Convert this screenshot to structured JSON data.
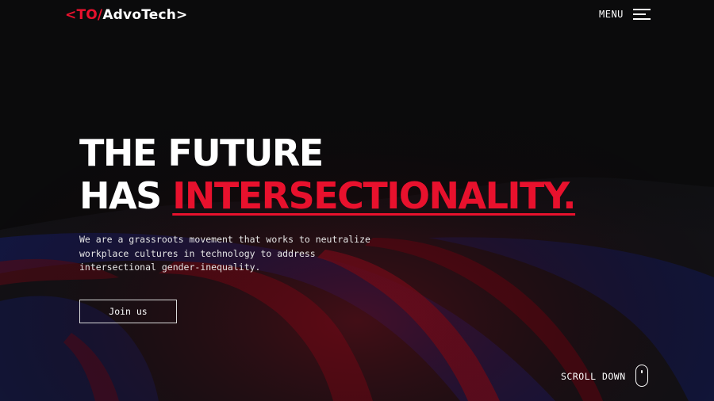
{
  "header": {
    "logo": {
      "prefix": "<TO/",
      "name": "AdvoTech",
      "suffix": ">"
    },
    "menu_label": "MENU",
    "menu_icon": "hamburger-menu-icon"
  },
  "hero": {
    "headline_line1": "THE FUTURE",
    "headline_line2_prefix": "HAS",
    "headline_line2_accent": "INTERSECTIONALITY.",
    "description": "We are a grassroots movement that works to neutralize workplace cultures in technology to address intersectional gender-inequality.",
    "cta_label": "Join us"
  },
  "scroll": {
    "label": "SCROLL DOWN",
    "icon": "mouse-scroll-icon"
  },
  "colors": {
    "background": "#0b0b0c",
    "accent": "#e8112d",
    "text": "#ffffff",
    "wave_blue": "#1a2a8c"
  }
}
